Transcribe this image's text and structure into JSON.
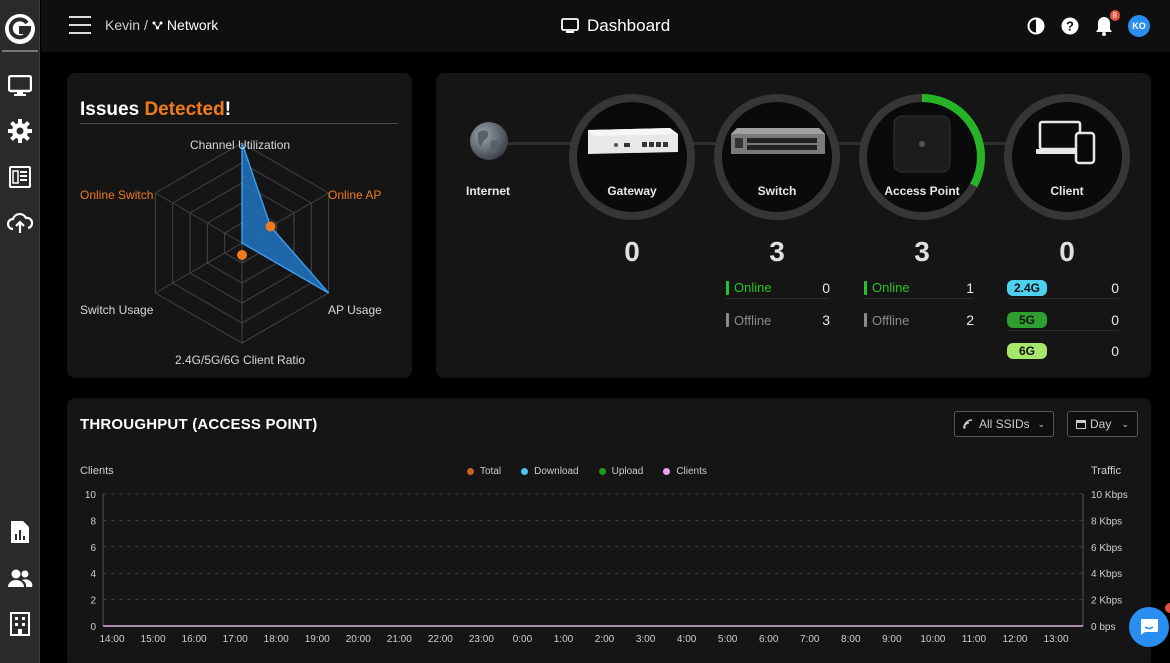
{
  "header": {
    "breadcrumb_user": "Kevin",
    "breadcrumb_sep": "/",
    "breadcrumb_network": "Network",
    "title": "Dashboard",
    "notification_count": "8",
    "avatar_initials": "KO"
  },
  "sidebar": {
    "items": [
      {
        "icon": "monitor-icon"
      },
      {
        "icon": "gear-icon"
      },
      {
        "icon": "list-icon"
      },
      {
        "icon": "cloud-sync-icon"
      },
      {
        "icon": "report-icon"
      },
      {
        "icon": "users-icon"
      },
      {
        "icon": "building-icon"
      }
    ]
  },
  "issues": {
    "title_prefix": "Issues",
    "title_accent": "Detected",
    "title_suffix": "!",
    "axes": {
      "channel_utilization": "Channel Utilization",
      "online_ap": "Online AP",
      "ap_usage": "AP Usage",
      "client_ratio": "2.4G/5G/6G Client Ratio",
      "switch_usage": "Switch Usage",
      "online_switch": "Online Switch"
    },
    "values": {
      "channel_utilization": 1.0,
      "online_ap": 0.33,
      "ap_usage": 1.0,
      "client_ratio": 0.0,
      "switch_usage": 0.0,
      "online_switch": 0.0
    }
  },
  "topology": {
    "internet_label": "Internet",
    "nodes": [
      {
        "label": "Gateway",
        "count": "0",
        "progress": 0
      },
      {
        "label": "Switch",
        "count": "3",
        "progress": 0
      },
      {
        "label": "Access Point",
        "count": "3",
        "progress": 0.33
      },
      {
        "label": "Client",
        "count": "0",
        "progress": 0
      }
    ],
    "switch_stats": {
      "online_label": "Online",
      "online": "0",
      "offline_label": "Offline",
      "offline": "3"
    },
    "ap_stats": {
      "online_label": "Online",
      "online": "1",
      "offline_label": "Offline",
      "offline": "2"
    },
    "client_bands": [
      {
        "band": "2.4G",
        "count": "0",
        "color": "#4fd0f0"
      },
      {
        "band": "5G",
        "count": "0",
        "color": "#2fa02f"
      },
      {
        "band": "6G",
        "count": "0",
        "color": "#a6e66a"
      }
    ],
    "colors": {
      "online": "#26c326",
      "offline": "#8a8a8a",
      "ring_progress": "#26b326"
    }
  },
  "throughput": {
    "title": "THROUGHPUT (ACCESS POINT)",
    "ssid_filter": "All SSIDs",
    "period_filter": "Day",
    "left_axis_title": "Clients",
    "right_axis_title": "Traffic",
    "legend": [
      {
        "name": "Total",
        "color": "#c8641e"
      },
      {
        "name": "Download",
        "color": "#4fc3f0"
      },
      {
        "name": "Upload",
        "color": "#1f9a1f"
      },
      {
        "name": "Clients",
        "color": "#f0a0f0"
      }
    ]
  },
  "chart_data": {
    "type": "line",
    "title": "THROUGHPUT (ACCESS POINT)",
    "xlabel": "",
    "ylabel": "Clients",
    "y2label": "Traffic",
    "x": [
      "14:00",
      "15:00",
      "16:00",
      "17:00",
      "18:00",
      "19:00",
      "20:00",
      "21:00",
      "22:00",
      "23:00",
      "0:00",
      "1:00",
      "2:00",
      "3:00",
      "4:00",
      "5:00",
      "6:00",
      "7:00",
      "8:00",
      "9:00",
      "10:00",
      "11:00",
      "12:00",
      "13:00"
    ],
    "ylim": [
      0,
      10
    ],
    "yticks": [
      "0",
      "2",
      "4",
      "6",
      "8",
      "10"
    ],
    "y2ticks": [
      "0 bps",
      "2 Kbps",
      "4 Kbps",
      "6 Kbps",
      "8 Kbps",
      "10 Kbps"
    ],
    "grid": true,
    "legend": "top-center",
    "series": [
      {
        "name": "Total",
        "values": [
          0,
          0,
          0,
          0,
          0,
          0,
          0,
          0,
          0,
          0,
          0,
          0,
          0,
          0,
          0,
          0,
          0,
          0,
          0,
          0,
          0,
          0,
          0,
          0
        ]
      },
      {
        "name": "Download",
        "values": [
          0,
          0,
          0,
          0,
          0,
          0,
          0,
          0,
          0,
          0,
          0,
          0,
          0,
          0,
          0,
          0,
          0,
          0,
          0,
          0,
          0,
          0,
          0,
          0
        ]
      },
      {
        "name": "Upload",
        "values": [
          0,
          0,
          0,
          0,
          0,
          0,
          0,
          0,
          0,
          0,
          0,
          0,
          0,
          0,
          0,
          0,
          0,
          0,
          0,
          0,
          0,
          0,
          0,
          0
        ]
      },
      {
        "name": "Clients",
        "values": [
          0,
          0,
          0,
          0,
          0,
          0,
          0,
          0,
          0,
          0,
          0,
          0,
          0,
          0,
          0,
          0,
          0,
          0,
          0,
          0,
          0,
          0,
          0,
          0
        ]
      }
    ]
  }
}
